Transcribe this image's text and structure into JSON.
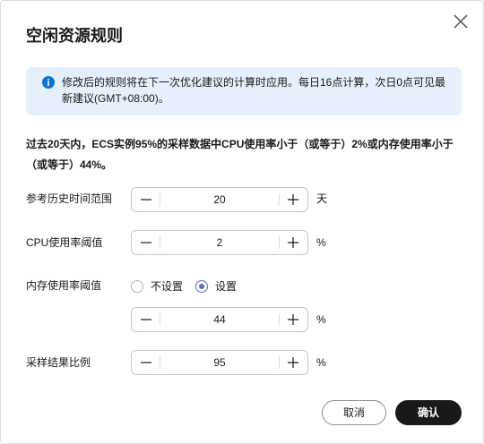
{
  "dialog": {
    "title": "空闲资源规则",
    "close_icon": "close-icon"
  },
  "notice": {
    "icon": "info-icon",
    "text": "修改后的规则将在下一次优化建议的计算时应用。每日16点计算，次日0点可见最新建议(GMT+08:00)。",
    "color": "#e5f0fc",
    "icon_color": "#0d74ce"
  },
  "summary": "过去20天内，ECS实例95%的采样数据中CPU使用率小于（或等于）2%或内存使用率小于（或等于）44%。",
  "fields": {
    "history": {
      "label": "参考历史时间范围",
      "value": "20",
      "unit": "天"
    },
    "cpu": {
      "label": "CPU使用率阈值",
      "value": "2",
      "unit": "%"
    },
    "memory": {
      "label": "内存使用率阈值",
      "options": [
        "不设置",
        "设置"
      ],
      "selected": "设置",
      "value": "44",
      "unit": "%"
    },
    "sample": {
      "label": "采样结果比例",
      "value": "95",
      "unit": "%"
    }
  },
  "icons": {
    "minus": "minus-icon",
    "plus": "plus-icon"
  },
  "footer": {
    "cancel_label": "取消",
    "confirm_label": "确认"
  },
  "colors": {
    "accent": "#526ecc",
    "primary_button": "#191919"
  }
}
